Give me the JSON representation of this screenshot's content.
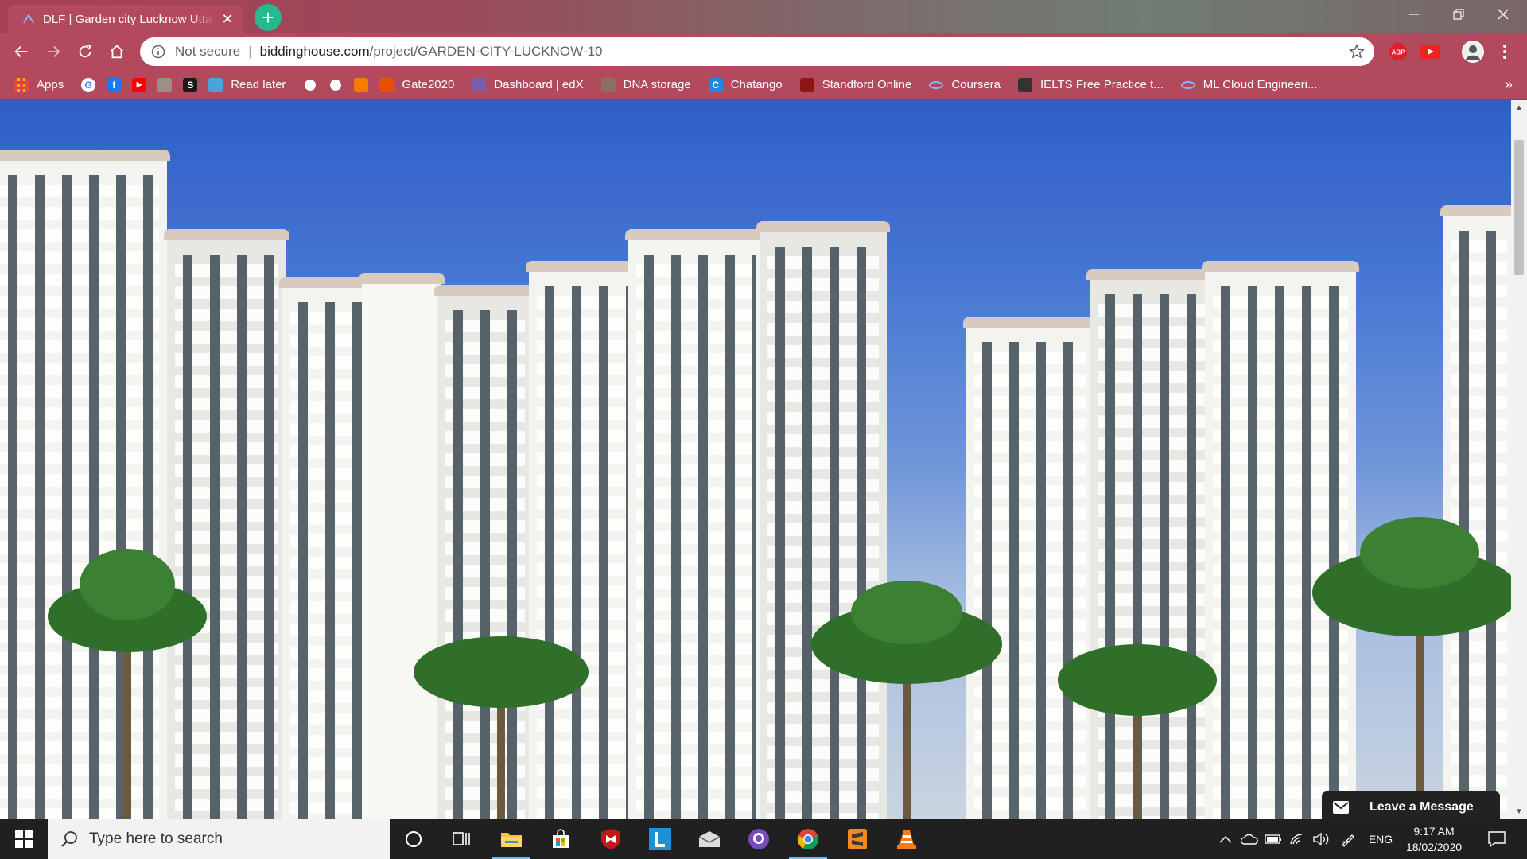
{
  "browser": {
    "tab_title": "DLF | Garden city Lucknow Uttar",
    "tab_close_glyph": "✕",
    "new_tab_glyph": "+",
    "security_label": "Not secure",
    "url_separator": "|",
    "url_host": "biddinghouse.com",
    "url_path": "/project/GARDEN-CITY-LUCKNOW-10",
    "extensions": [
      {
        "name": "adblock-plus-icon",
        "label": "ABP"
      },
      {
        "name": "youtube-extension-icon",
        "label": "▶"
      }
    ]
  },
  "bookmarks": [
    {
      "name": "bookmark-apps",
      "label": "Apps",
      "icon": "apps-grid-icon",
      "color": "#e8453c"
    },
    {
      "name": "bookmark-google",
      "label": "",
      "icon": "google-icon",
      "color": "#ffffff"
    },
    {
      "name": "bookmark-facebook",
      "label": "",
      "icon": "facebook-icon",
      "color": "#1877f2"
    },
    {
      "name": "bookmark-youtube",
      "label": "",
      "icon": "youtube-icon",
      "color": "#ff0000"
    },
    {
      "name": "bookmark-book",
      "label": "",
      "icon": "book-icon",
      "color": "#9e8f86"
    },
    {
      "name": "bookmark-scribd",
      "label": "",
      "icon": "scribd-icon",
      "color": "#1a1a1a"
    },
    {
      "name": "bookmark-read-later",
      "label": "Read later",
      "icon": "read-later-icon",
      "color": "#4aa3df"
    },
    {
      "name": "bookmark-globe-1",
      "label": "",
      "icon": "globe-icon",
      "color": "#ffffff"
    },
    {
      "name": "bookmark-globe-2",
      "label": "",
      "icon": "globe-icon",
      "color": "#ffffff"
    },
    {
      "name": "bookmark-orange",
      "label": "",
      "icon": "orange-square-icon",
      "color": "#f57c00"
    },
    {
      "name": "bookmark-gate2020",
      "label": "Gate2020",
      "icon": "gate-icon",
      "color": "#e65100"
    },
    {
      "name": "bookmark-edx",
      "label": "Dashboard | edX",
      "icon": "edx-icon",
      "color": "#7b5ea7"
    },
    {
      "name": "bookmark-dna",
      "label": "DNA storage",
      "icon": "dna-icon",
      "color": "#8d6e63"
    },
    {
      "name": "bookmark-chatango",
      "label": "Chatango",
      "icon": "chatango-icon",
      "color": "#1e88e5"
    },
    {
      "name": "bookmark-stanford",
      "label": "Standford Online",
      "icon": "stanford-icon",
      "color": "#8c1515"
    },
    {
      "name": "bookmark-coursera",
      "label": "Coursera",
      "icon": "coursera-icon",
      "color": "#2a73cc"
    },
    {
      "name": "bookmark-ielts",
      "label": "IELTS Free Practice t...",
      "icon": "ielts-icon",
      "color": "#333333"
    },
    {
      "name": "bookmark-ml-cloud",
      "label": "ML Cloud Engineeri...",
      "icon": "coursera-icon",
      "color": "#2a73cc"
    }
  ],
  "bookmarks_overflow": "»",
  "page": {
    "watermark": "",
    "chat_label": "Leave a Message"
  },
  "taskbar": {
    "search_placeholder": "Type here to search",
    "time": "9:17 AM",
    "date": "18/02/2020",
    "language": "ENG"
  }
}
